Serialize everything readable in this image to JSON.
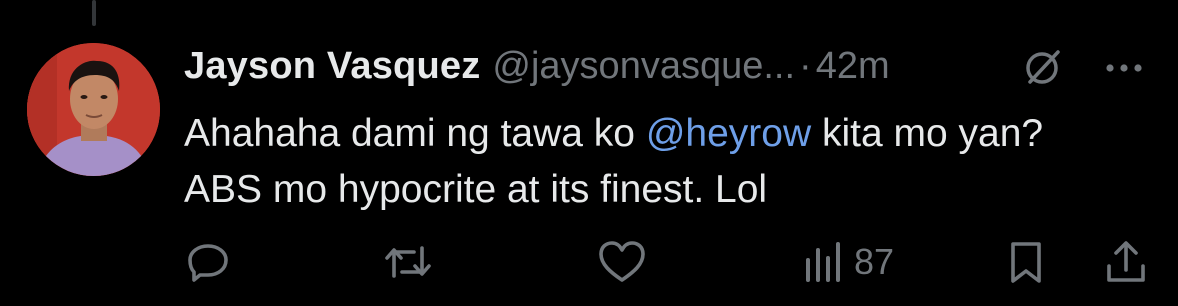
{
  "tweet": {
    "display_name": "Jayson Vasquez",
    "handle": "@jaysonvasque...",
    "separator": "·",
    "time": "42m",
    "text_before": "Ahahaha dami ng tawa ko ",
    "mention": "@heyrow",
    "text_after": " kita mo yan? ABS mo hypocrite at its finest. Lol",
    "icons": {
      "header_right": [
        "grok-icon",
        "more-icon"
      ]
    }
  },
  "actions": {
    "reply": {
      "icon": "reply-icon"
    },
    "retweet": {
      "icon": "retweet-icon"
    },
    "like": {
      "icon": "heart-icon"
    },
    "views": {
      "icon": "views-icon",
      "count": "87"
    },
    "bookmark": {
      "icon": "bookmark-icon"
    },
    "share": {
      "icon": "share-icon"
    }
  },
  "colors": {
    "background": "#000000",
    "primary_text": "#e7e9ea",
    "secondary_text": "#71767b",
    "mention": "#6e9fe8"
  }
}
